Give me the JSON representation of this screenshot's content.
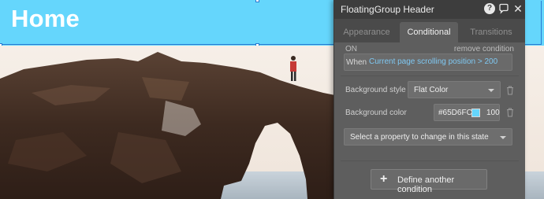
{
  "page": {
    "title": "Home",
    "header_color": "#65D6FC"
  },
  "panel": {
    "title": "FloatingGroup Header",
    "icons": {
      "help": "help-circle-icon",
      "comment": "comment-icon",
      "close": "close-icon"
    },
    "help_glyph": "?",
    "close_glyph": "✕",
    "tabs": [
      {
        "label": "Appearance",
        "active": false
      },
      {
        "label": "Conditional",
        "active": true
      },
      {
        "label": "Transitions",
        "active": false
      }
    ],
    "condition": {
      "on_label": "ON",
      "remove_label": "remove condition",
      "when_label": "When",
      "expression": "Current page scrolling position > 200"
    },
    "properties": [
      {
        "label": "Background style",
        "value": "Flat Color"
      },
      {
        "label": "Background color",
        "hex": "#65D6FC",
        "opacity": "100"
      }
    ],
    "add_property_placeholder": "Select a property to change in this state",
    "define_button": {
      "plus": "+",
      "label": "Define another condition"
    }
  }
}
